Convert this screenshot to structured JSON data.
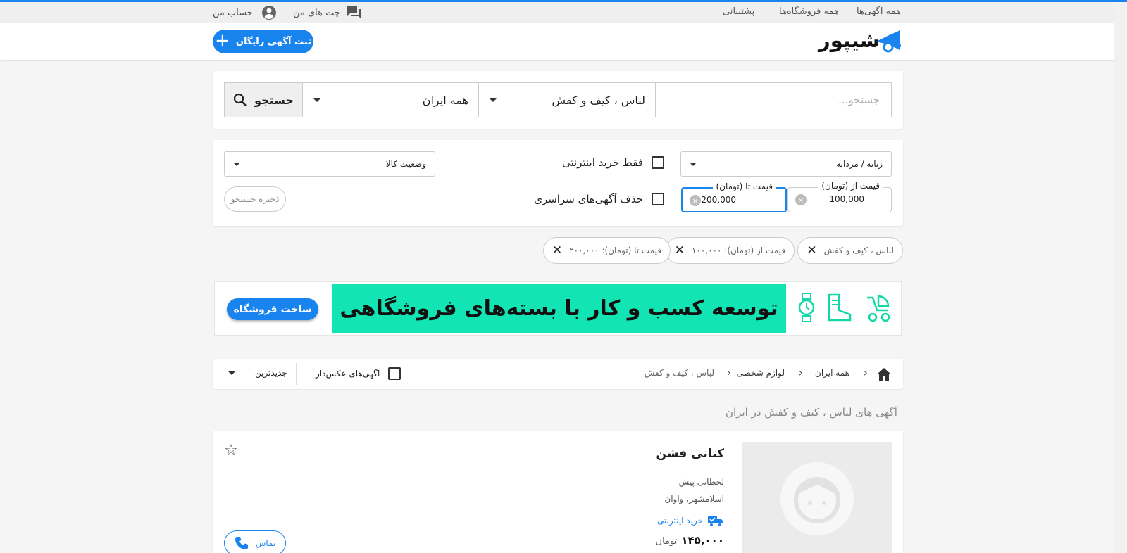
{
  "topbar": {
    "all_ads": "همه آگهی‌ها",
    "all_stores": "همه فروشگاه‌ها",
    "support": "پشتیبانی",
    "chats": "چت های من",
    "account": "حساب من"
  },
  "header": {
    "logo_text": "شیپور",
    "post_ad": "ثبت آگهی رایگان"
  },
  "search": {
    "placeholder": "جستجو...",
    "category": "لباس ، کیف و کفش",
    "location": "همه ایران",
    "button": "جستجو"
  },
  "filters": {
    "gender": "زنانه / مردانه",
    "online_only": "فقط خرید اینترنتی",
    "condition": "وضعیت کالا",
    "price_from_label": "قیمت از (تومان)",
    "price_from_value": "100,000",
    "price_to_label": "قیمت تا (تومان)",
    "price_to_value": "200,000",
    "remove_nationwide": "حذف آگهی‌های سراسری",
    "save_search": "ذخیره جستجو"
  },
  "chips": [
    {
      "label": "لباس ، کیف و کفش"
    },
    {
      "label": "قیمت از (تومان): ۱۰۰,۰۰۰"
    },
    {
      "label": "قیمت تا (تومان): ۲۰۰,۰۰۰"
    }
  ],
  "banner": {
    "headline": "توسعه کسب و کار با بسته‌های فروشگاهی",
    "button": "ساخت فروشگاه"
  },
  "breadcrumb": {
    "all_iran": "همه ایران",
    "personal": "لوازم شخصی",
    "clothing": "لباس ، کیف و کفش",
    "photo_only": "آگهی‌های عکس‌دار",
    "sort": "جدیدترین"
  },
  "page_title": "آگهی های لباس ، کیف و کفش در ایران",
  "listing": {
    "title": "کتانی فشن",
    "time": "لحظاتی پیش",
    "location": "اسلامشهر، واوان",
    "online": "خرید اینترنتی",
    "price": "۱۴۵,۰۰۰",
    "currency": "تومان",
    "call": "تماس"
  },
  "colors": {
    "accent": "#1a84ee",
    "banner_green": "#12e5b3"
  }
}
